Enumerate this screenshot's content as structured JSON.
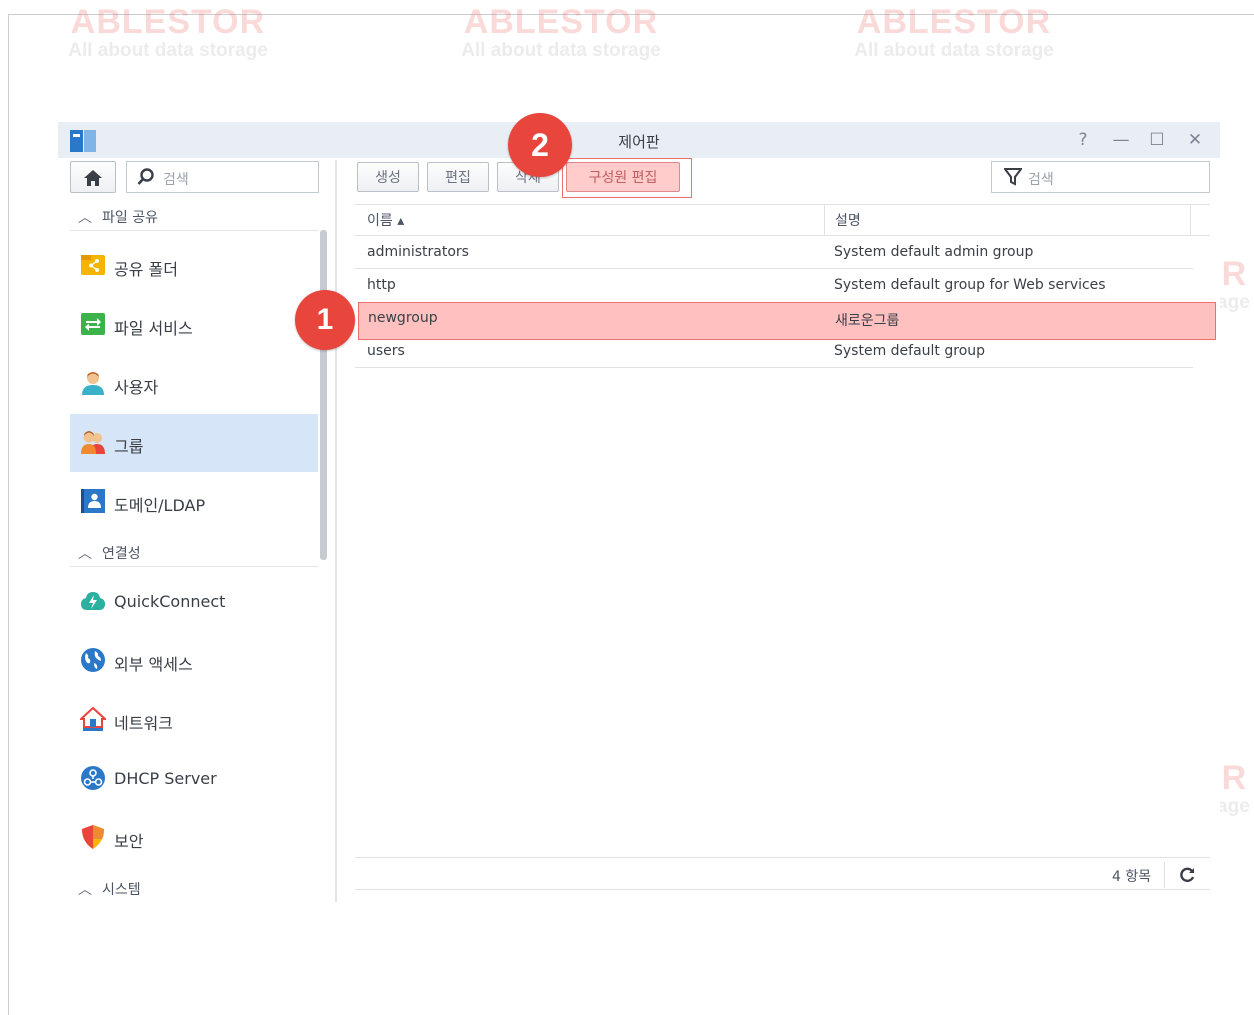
{
  "watermark": {
    "brand": "ABLESTOR",
    "tagline": "All about data storage"
  },
  "window": {
    "title": "제어판",
    "controls": {
      "help": "?",
      "minimize": "—",
      "maximize": "☐",
      "close": "✕"
    }
  },
  "sidebar": {
    "home_icon": "home-icon",
    "search_placeholder": "검색",
    "sections": [
      {
        "label": "파일 공유",
        "items": [
          {
            "label": "공유 폴더",
            "icon": "shared-folder-icon"
          },
          {
            "label": "파일 서비스",
            "icon": "file-services-icon"
          },
          {
            "label": "사용자",
            "icon": "user-icon"
          },
          {
            "label": "그룹",
            "icon": "group-icon",
            "active": true
          },
          {
            "label": "도메인/LDAP",
            "icon": "domain-ldap-icon"
          }
        ]
      },
      {
        "label": "연결성",
        "items": [
          {
            "label": "QuickConnect",
            "icon": "quickconnect-icon"
          },
          {
            "label": "외부 액세스",
            "icon": "external-access-icon"
          },
          {
            "label": "네트워크",
            "icon": "network-icon"
          },
          {
            "label": "DHCP Server",
            "icon": "dhcp-server-icon"
          },
          {
            "label": "보안",
            "icon": "security-icon"
          }
        ]
      },
      {
        "label": "시스템",
        "items": []
      }
    ]
  },
  "toolbar": {
    "create": "생성",
    "edit": "편집",
    "delete": "삭제",
    "edit_members": "구성원 편집",
    "filter_placeholder": "검색"
  },
  "table": {
    "columns": [
      "이름 ▴",
      "설명"
    ],
    "rows": [
      {
        "name": "administrators",
        "description": "System default admin group"
      },
      {
        "name": "http",
        "description": "System default group for Web services"
      },
      {
        "name": "newgroup",
        "description": "새로운그룹",
        "selected": true
      },
      {
        "name": "users",
        "description": "System default group"
      }
    ]
  },
  "footer": {
    "count": "4 항목",
    "refresh_icon": "refresh-icon"
  },
  "annotations": [
    "1",
    "2"
  ],
  "colors": {
    "accent": "#e8453c",
    "highlight": "#ff8c8c",
    "active_nav": "#d6e5f7"
  }
}
